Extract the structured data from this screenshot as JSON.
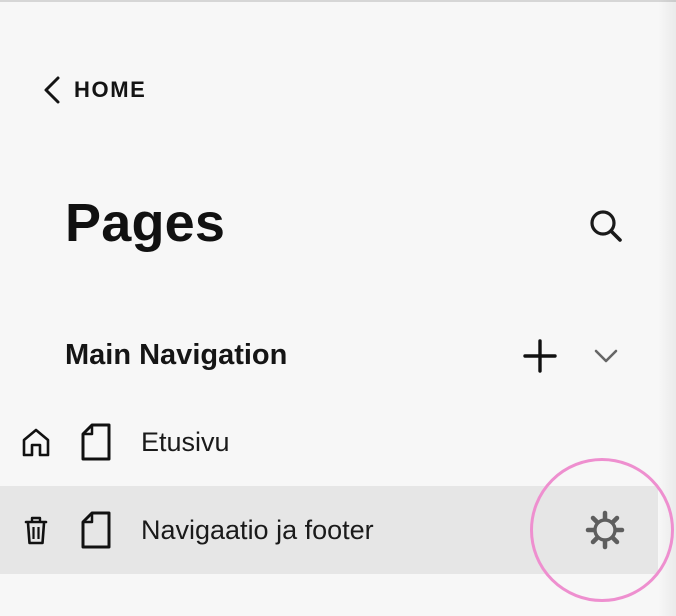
{
  "nav": {
    "back_label": "HOME",
    "back_icon": "chevron-left-icon"
  },
  "header": {
    "title": "Pages",
    "search_icon": "search-icon"
  },
  "section": {
    "title": "Main Navigation",
    "add_icon": "plus-icon",
    "collapse_icon": "chevron-down-icon",
    "items": [
      {
        "label": "Etusivu",
        "lead_icon": "home-icon",
        "type_icon": "page-icon"
      },
      {
        "label": "Navigaatio ja footer",
        "lead_icon": "trash-icon",
        "type_icon": "page-icon",
        "action_icon": "gear-icon",
        "hovered": true
      }
    ]
  },
  "colors": {
    "background": "#f7f7f7",
    "row_hover": "#e6e6e6",
    "text": "#141414",
    "icon_muted": "#5e5e5e",
    "highlight_ring": "#ee8fcf"
  }
}
